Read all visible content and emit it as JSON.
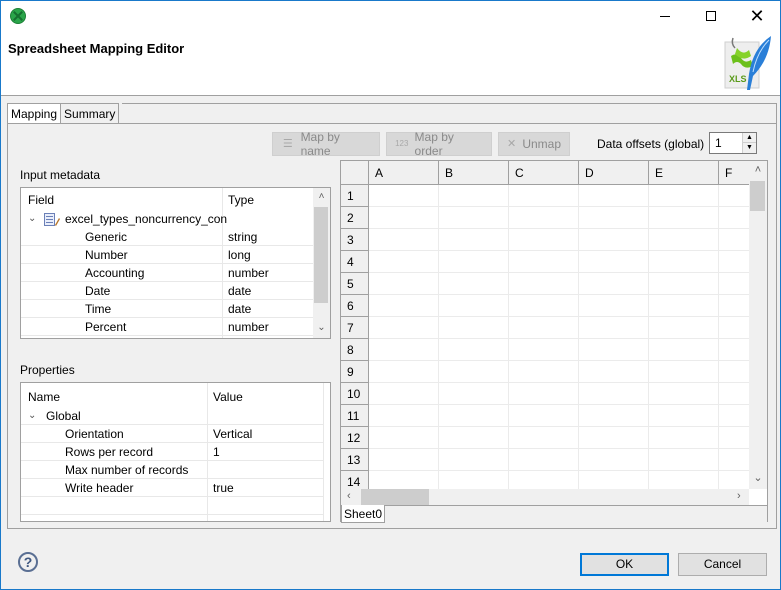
{
  "window": {
    "app_icon": "clover-app-icon",
    "controls": {
      "minimize": "minimize-icon",
      "maximize": "maximize-icon",
      "close": "close-icon"
    }
  },
  "header": {
    "title": "Spreadsheet Mapping Editor",
    "icon": "xls-quill-icon",
    "icon_label": "XLS"
  },
  "tabs": [
    {
      "label": "Mapping",
      "active": true
    },
    {
      "label": "Summary",
      "active": false
    }
  ],
  "toolbar": {
    "map_by_name": {
      "label": "Map by name",
      "icon": "map-by-name-icon",
      "enabled": false
    },
    "map_by_order": {
      "label": "Map by order",
      "icon": "map-by-order-icon",
      "enabled": false
    },
    "unmap": {
      "label": "Unmap",
      "icon": "x-icon",
      "enabled": false
    },
    "data_offsets_label": "Data offsets (global)",
    "data_offsets_value": "1"
  },
  "input_metadata": {
    "label": "Input metadata",
    "columns": [
      "Field",
      "Type"
    ],
    "root": {
      "name": "excel_types_noncurrency_con",
      "icon": "metadata-record-icon",
      "expanded": true
    },
    "rows": [
      {
        "field": "Generic",
        "type": "string"
      },
      {
        "field": "Number",
        "type": "long"
      },
      {
        "field": "Accounting",
        "type": "number"
      },
      {
        "field": "Date",
        "type": "date"
      },
      {
        "field": "Time",
        "type": "date"
      },
      {
        "field": "Percent",
        "type": "number"
      }
    ]
  },
  "properties": {
    "label": "Properties",
    "columns": [
      "Name",
      "Value"
    ],
    "group": {
      "name": "Global",
      "expanded": true
    },
    "rows": [
      {
        "name": "Orientation",
        "value": "Vertical"
      },
      {
        "name": "Rows per record",
        "value": "1"
      },
      {
        "name": "Max number of records",
        "value": ""
      },
      {
        "name": "Write header",
        "value": "true"
      }
    ]
  },
  "spreadsheet": {
    "columns": [
      "A",
      "B",
      "C",
      "D",
      "E",
      "F"
    ],
    "rows": [
      "1",
      "2",
      "3",
      "4",
      "5",
      "6",
      "7",
      "8",
      "9",
      "10",
      "11",
      "12",
      "13",
      "14"
    ],
    "sheet_tabs": [
      "Sheet0"
    ]
  },
  "footer": {
    "help_icon": "help-icon",
    "help_glyph": "?",
    "ok_label": "OK",
    "cancel_label": "Cancel"
  },
  "glyphs": {
    "chevron_down": "⌄",
    "chevron_up": "˄",
    "arrow_left": "‹",
    "arrow_right": "›",
    "spin_up": "▲",
    "spin_down": "▼",
    "x": "✕",
    "close": "✕"
  }
}
